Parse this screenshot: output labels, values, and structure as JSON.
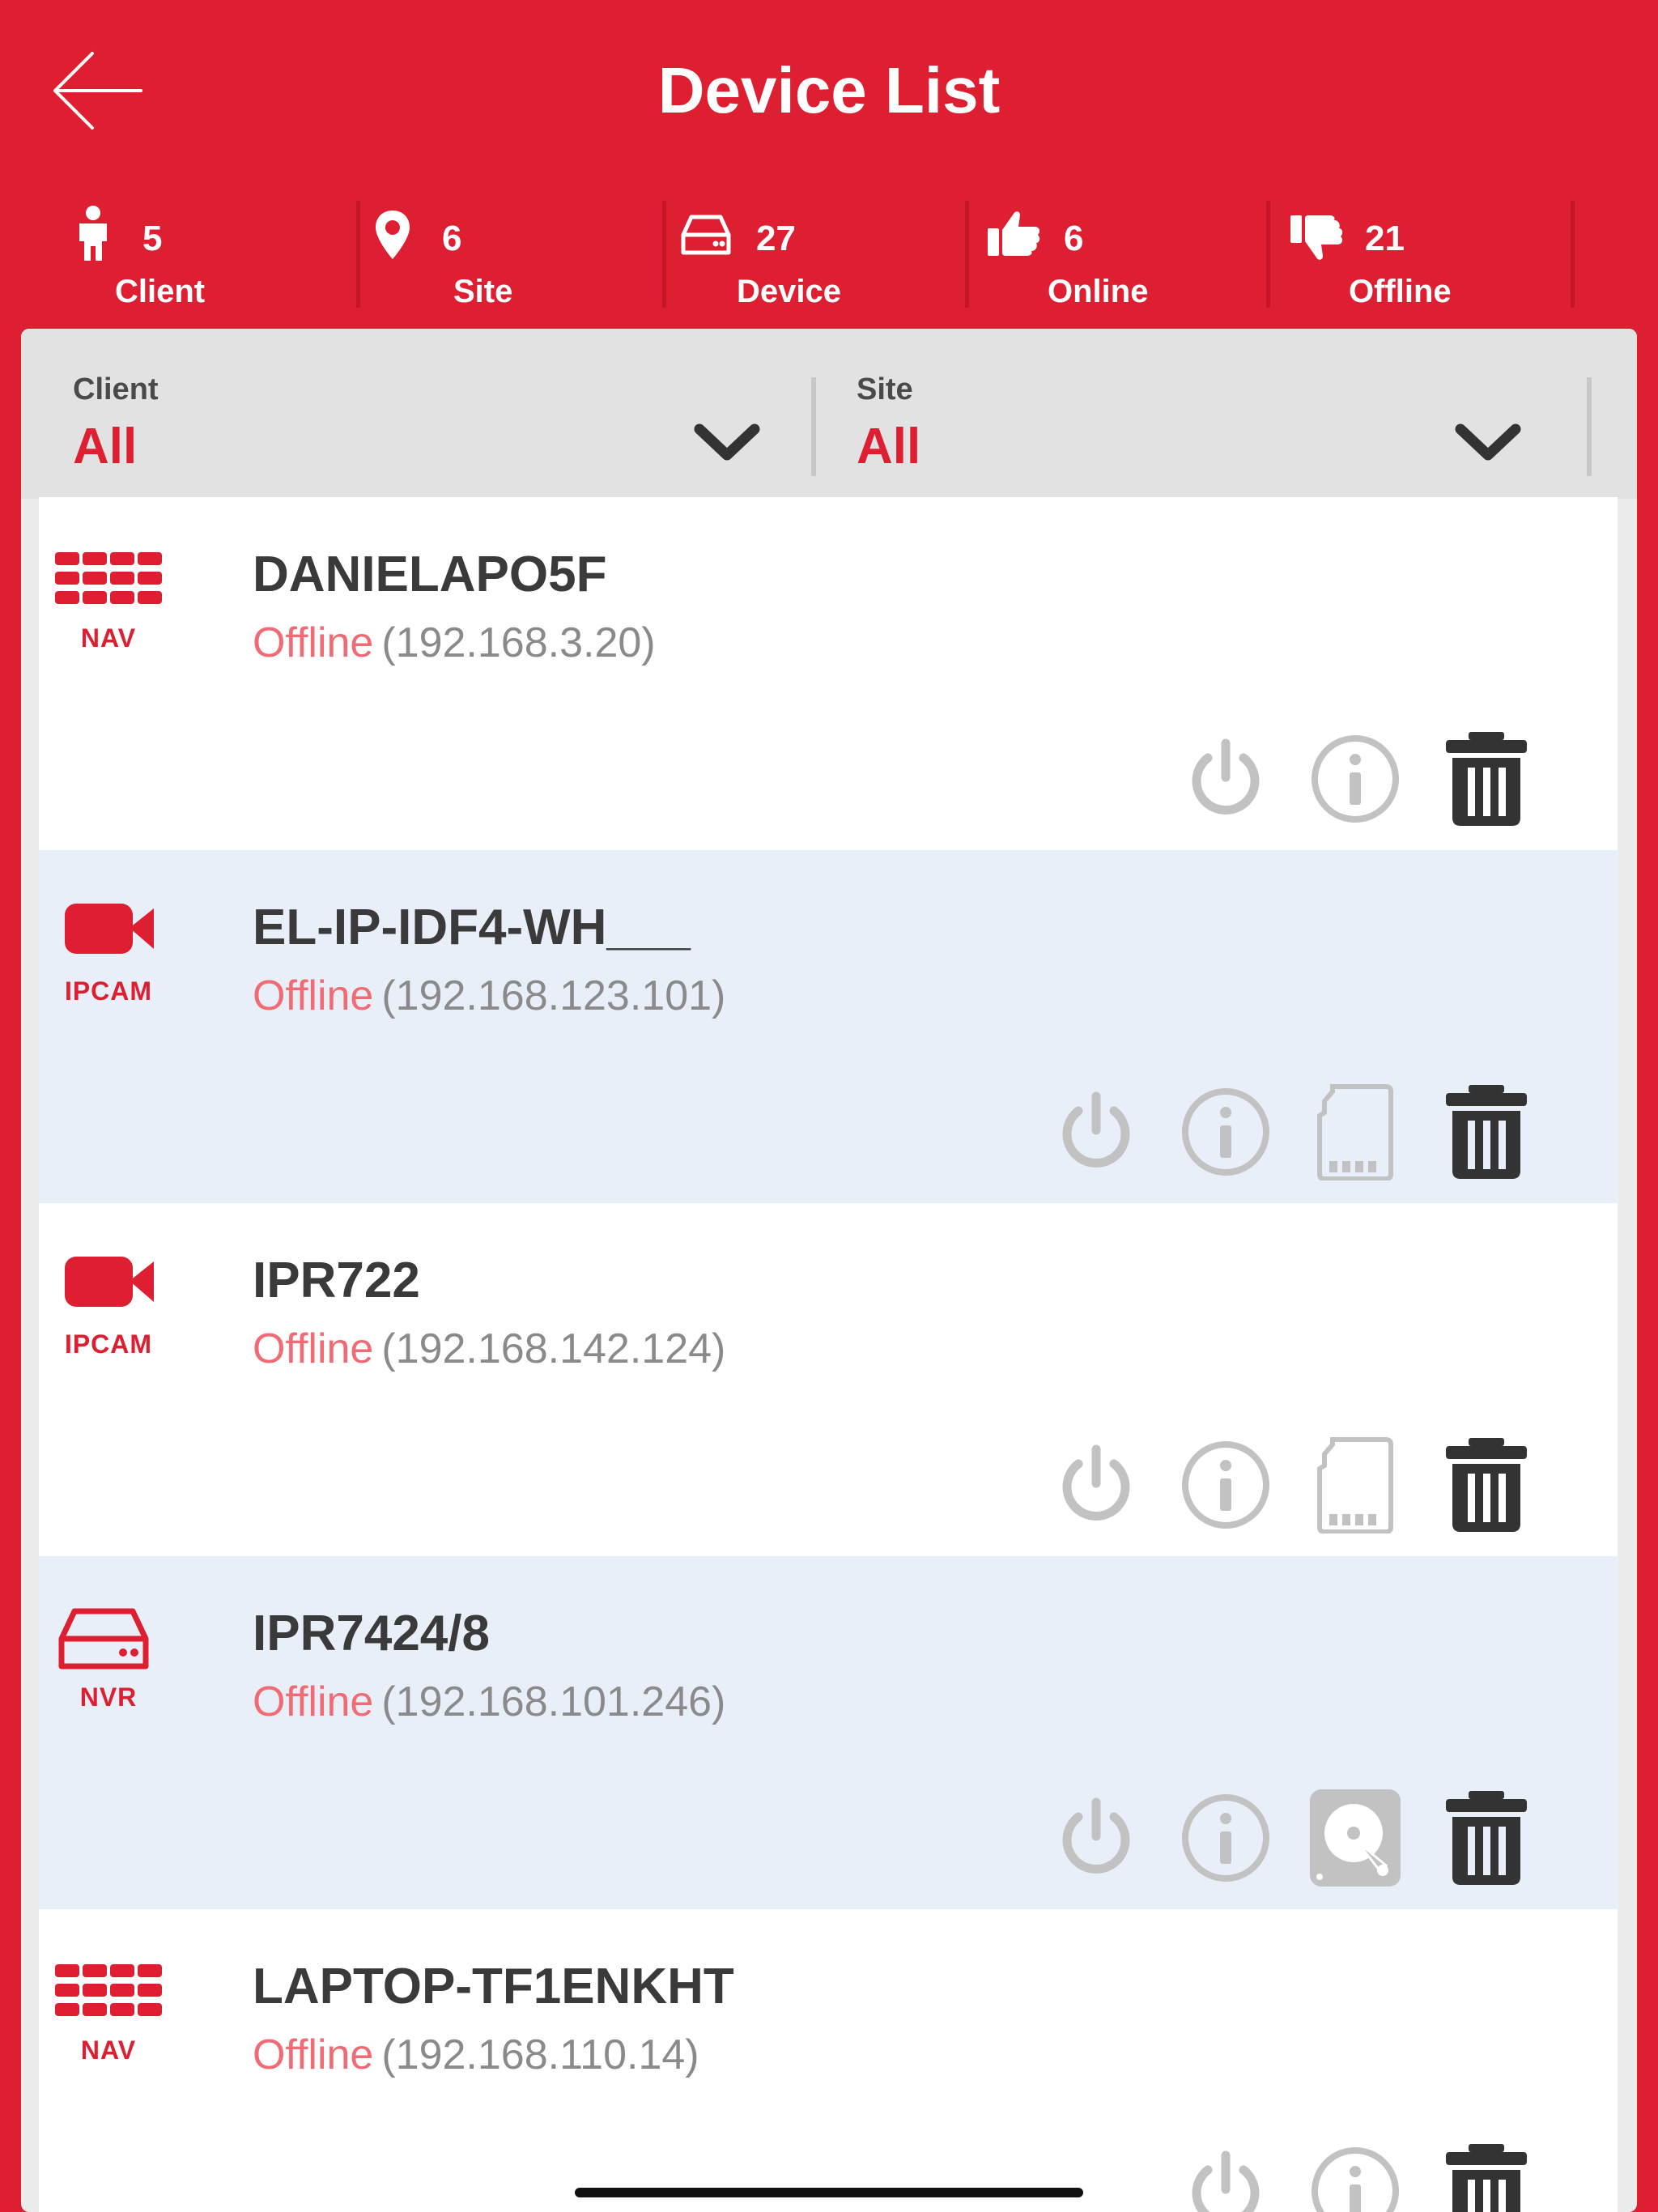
{
  "header": {
    "title": "Device List"
  },
  "stats": [
    {
      "icon": "person-icon",
      "count": "5",
      "label": "Client"
    },
    {
      "icon": "map-pin-icon",
      "count": "6",
      "label": "Site"
    },
    {
      "icon": "hard-drive-icon",
      "count": "27",
      "label": "Device"
    },
    {
      "icon": "thumbs-up-icon",
      "count": "6",
      "label": "Online"
    },
    {
      "icon": "thumbs-down-icon",
      "count": "21",
      "label": "Offline"
    }
  ],
  "filters": {
    "client": {
      "label": "Client",
      "value": "All"
    },
    "site": {
      "label": "Site",
      "value": "All"
    }
  },
  "devices": [
    {
      "type": "NAV",
      "name": "DANIELAPO5F",
      "status": "Offline",
      "ip": "(192.168.3.20)",
      "actions": [
        "power-icon",
        "info-icon",
        "trash-icon"
      ]
    },
    {
      "type": "IPCAM",
      "name": "EL-IP-IDF4-WH___",
      "status": "Offline",
      "ip": "(192.168.123.101)",
      "actions": [
        "power-icon",
        "info-icon",
        "sd-card-icon",
        "trash-icon"
      ]
    },
    {
      "type": "IPCAM",
      "name": "IPR722",
      "status": "Offline",
      "ip": "(192.168.142.124)",
      "actions": [
        "power-icon",
        "info-icon",
        "sd-card-icon",
        "trash-icon"
      ]
    },
    {
      "type": "NVR",
      "name": "IPR7424/8",
      "status": "Offline",
      "ip": "(192.168.101.246)",
      "actions": [
        "power-icon",
        "info-icon",
        "hdd-icon",
        "trash-icon"
      ]
    },
    {
      "type": "NAV",
      "name": "LAPTOP-TF1ENKHT",
      "status": "Offline",
      "ip": "(192.168.110.14)",
      "actions": [
        "power-icon",
        "info-icon",
        "trash-icon"
      ]
    }
  ],
  "colors": {
    "brand_red": "#dd1f31",
    "offline": "#f06b74",
    "alt_row": "#e9eff8"
  }
}
